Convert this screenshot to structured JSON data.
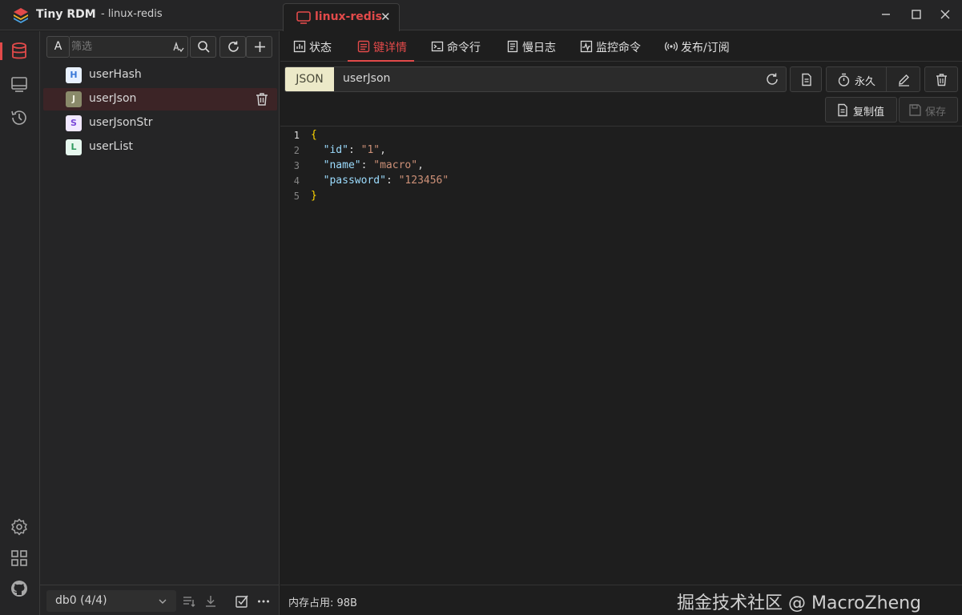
{
  "window": {
    "app_title": "Tiny RDM",
    "app_subtitle": "- linux-redis",
    "connection_tab": "linux-redis",
    "close_glyph": "✕"
  },
  "nav": {
    "items": [
      {
        "icon": "database-icon",
        "active": true
      },
      {
        "icon": "terminal-window-icon"
      },
      {
        "icon": "history-icon"
      },
      {
        "icon": "settings-icon"
      },
      {
        "icon": "grid-apps-icon"
      },
      {
        "icon": "github-icon"
      }
    ]
  },
  "keypanel": {
    "case_toggle": "A",
    "filter_placeholder": "筛选",
    "keys": [
      {
        "type": "H",
        "name": "userHash",
        "badge_bg": "#e8f1ff",
        "badge_fg": "#3a78d8"
      },
      {
        "type": "J",
        "name": "userJson",
        "badge_bg": "#8a8a6a",
        "badge_fg": "#f0f0e0",
        "selected": true
      },
      {
        "type": "S",
        "name": "userJsonStr",
        "badge_bg": "#f1e8ff",
        "badge_fg": "#7a48d8"
      },
      {
        "type": "L",
        "name": "userList",
        "badge_bg": "#e6f7ee",
        "badge_fg": "#2e9a5e"
      }
    ],
    "db_select": "db0 (4/4)"
  },
  "subtabs": [
    {
      "label": "状态",
      "icon": "status-chart-icon"
    },
    {
      "label": "键详情",
      "icon": "key-detail-icon",
      "active": true
    },
    {
      "label": "命令行",
      "icon": "terminal-icon"
    },
    {
      "label": "慢日志",
      "icon": "log-icon"
    },
    {
      "label": "监控命令",
      "icon": "monitor-icon"
    },
    {
      "label": "发布/订阅",
      "icon": "broadcast-icon"
    }
  ],
  "keydetail": {
    "type": "JSON",
    "key_name": "userJson",
    "ttl_label": "永久",
    "copy_value_label": "复制值",
    "save_label": "保存"
  },
  "editor": {
    "lines": [
      {
        "n": "1",
        "text": "{"
      },
      {
        "n": "2",
        "text": "  \"id\": \"1\","
      },
      {
        "n": "3",
        "text": "  \"name\": \"macro\","
      },
      {
        "n": "4",
        "text": "  \"password\": \"123456\""
      },
      {
        "n": "5",
        "text": "}"
      }
    ]
  },
  "status": {
    "memory_label": "内存占用: 98B",
    "watermark": "掘金技术社区 @ MacroZheng"
  },
  "colors": {
    "accent": "#e24a4a",
    "background": "#1e1e1e",
    "panel": "#252526"
  }
}
